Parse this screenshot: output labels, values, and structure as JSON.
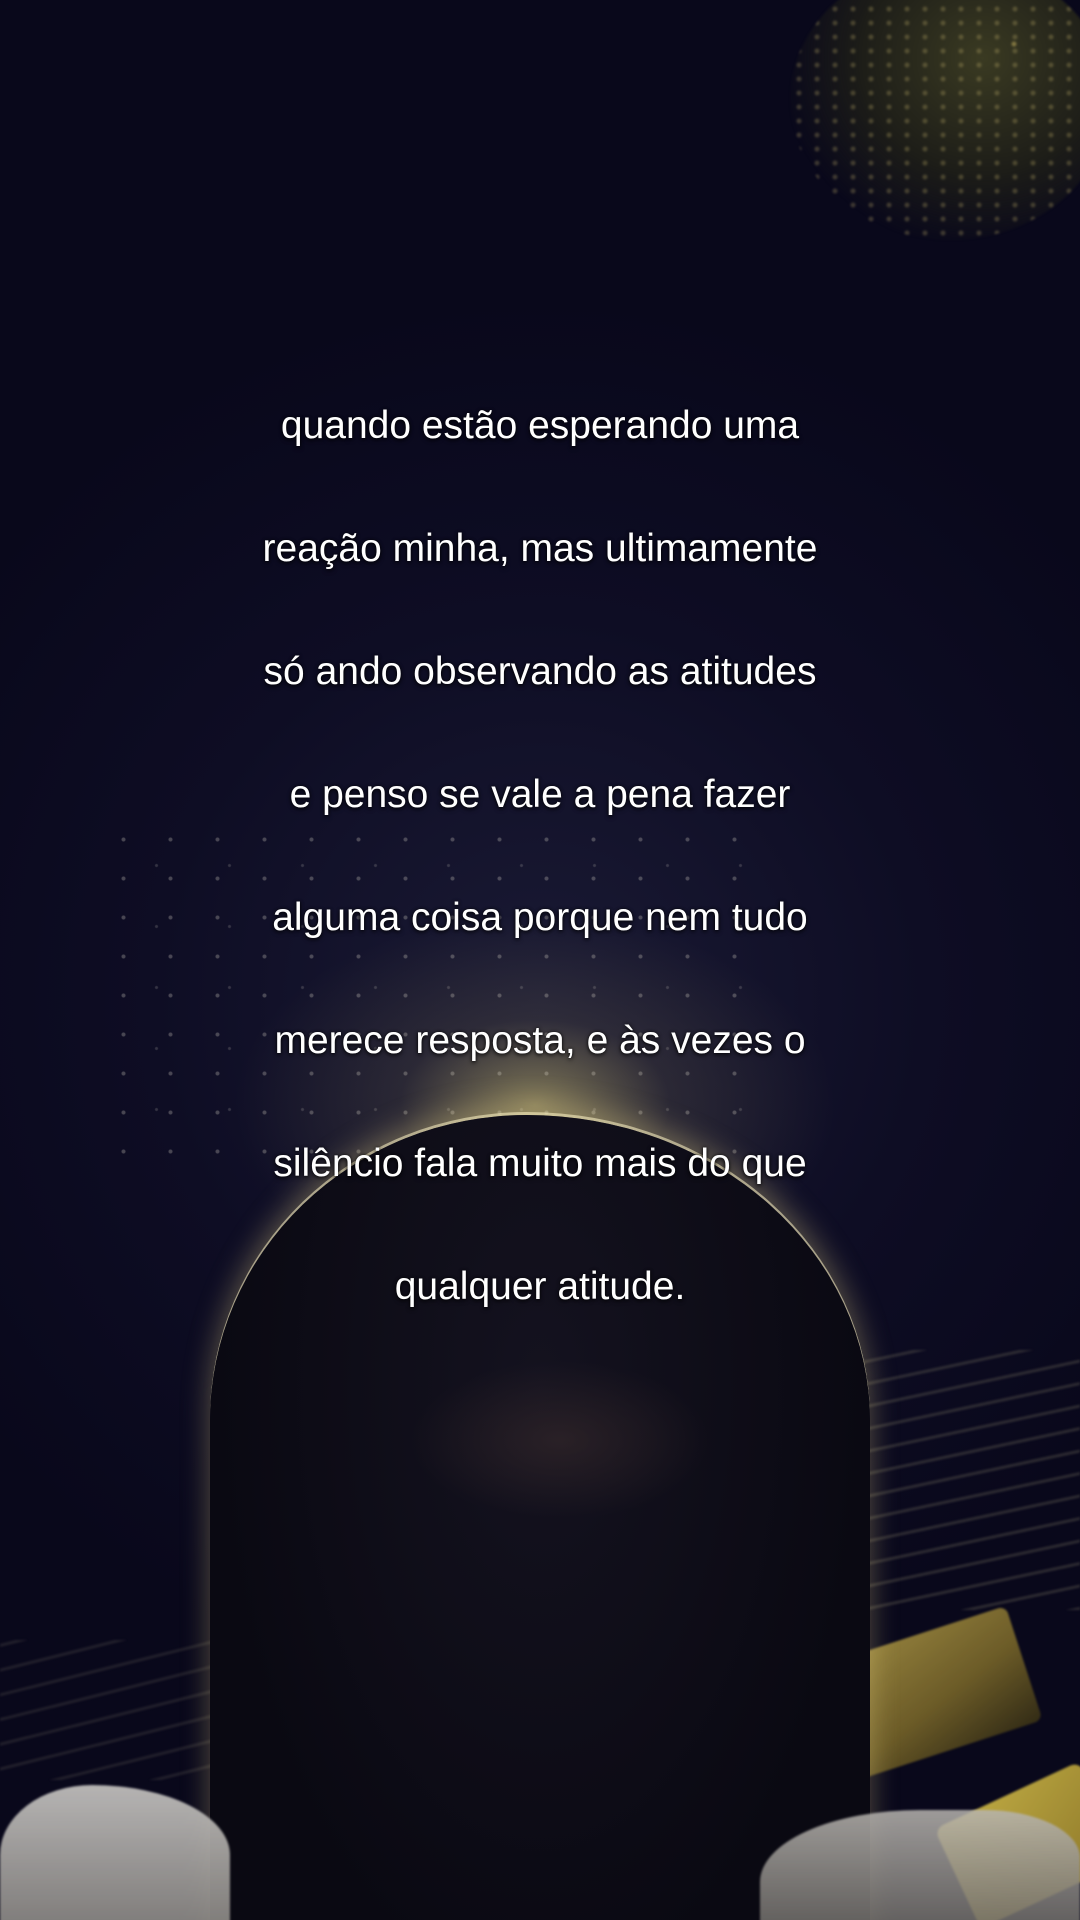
{
  "video": {
    "caption_lines": [
      "quando estão esperando uma",
      "reação minha, mas ultimamente",
      "só ando observando as atitudes",
      "e penso se vale a pena fazer",
      "alguma coisa porque nem tudo",
      "merece resposta, e às vezes o",
      "silêncio fala muito mais do que",
      "qualquer atitude."
    ]
  }
}
